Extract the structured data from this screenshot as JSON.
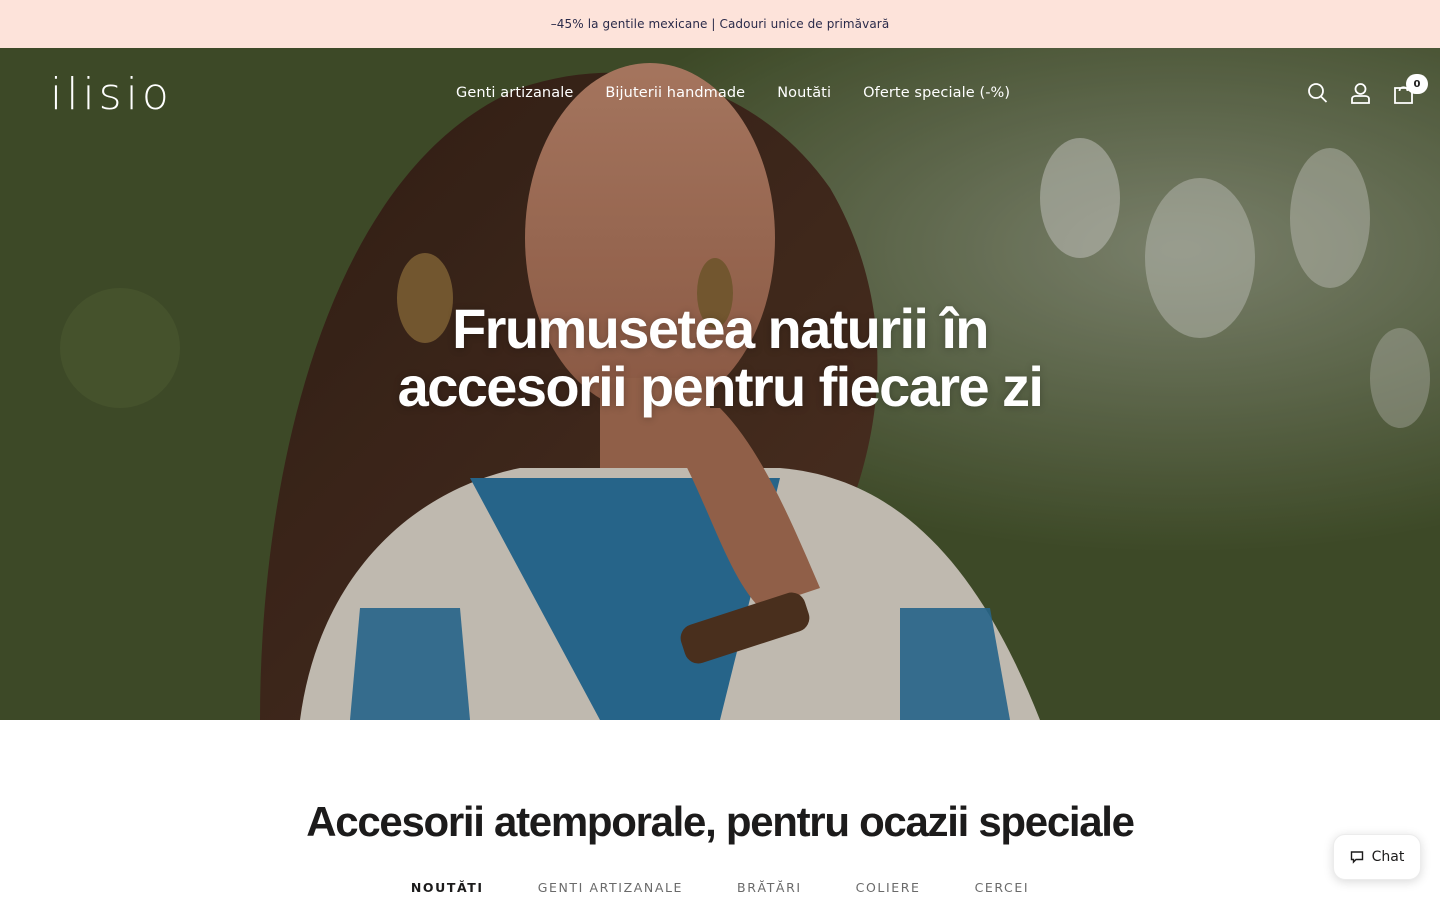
{
  "announcement": {
    "text": "–45% la gentile mexicane | Cadouri unice de primăvară"
  },
  "header": {
    "logo": "ilisio",
    "nav": [
      {
        "label": "Genti artizanale"
      },
      {
        "label": "Bijuterii handmade"
      },
      {
        "label": "Noutăti"
      },
      {
        "label": "Oferte speciale (-%)"
      }
    ],
    "icons": {
      "search": "search-icon",
      "account": "user-icon",
      "cart": "cart-icon"
    },
    "cart_count": "0"
  },
  "hero": {
    "title_line1": "Frumusetea naturii în",
    "title_line2": "accesorii pentru fiecare zi"
  },
  "collection": {
    "title": "Accesorii atemporale, pentru ocazii speciale",
    "tabs": [
      {
        "label": "NOUTĂTI",
        "active": true
      },
      {
        "label": "GENTI ARTIZANALE",
        "active": false
      },
      {
        "label": "BRĂTĂRI",
        "active": false
      },
      {
        "label": "COLIERE",
        "active": false
      },
      {
        "label": "CERCEI",
        "active": false
      }
    ]
  },
  "chat": {
    "label": "Chat",
    "icon": "chat-bubble-icon"
  },
  "colors": {
    "announcement_bg": "#fde3da",
    "text_dark": "#1c1b1b",
    "hero_overlay_text": "#ffffff"
  }
}
